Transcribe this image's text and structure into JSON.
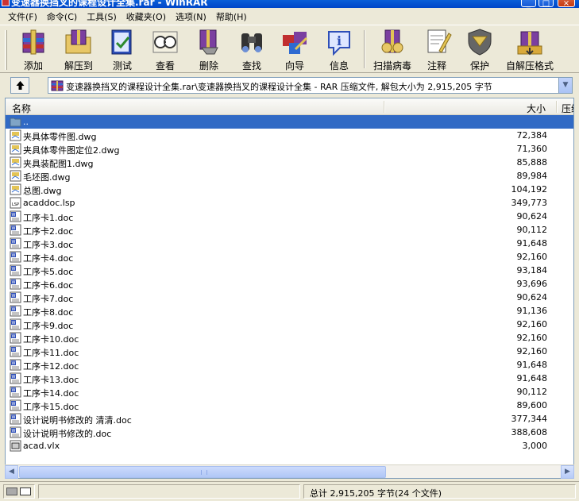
{
  "window": {
    "title": "变速器换挡叉的课程设计全集.rar - WinRAR"
  },
  "menu": [
    {
      "label": "文件(F)"
    },
    {
      "label": "命令(C)"
    },
    {
      "label": "工具(S)"
    },
    {
      "label": "收藏夹(O)"
    },
    {
      "label": "选项(N)"
    },
    {
      "label": "帮助(H)"
    }
  ],
  "toolbar": {
    "add": "添加",
    "extract": "解压到",
    "test": "测试",
    "view": "查看",
    "delete": "删除",
    "find": "查找",
    "wizard": "向导",
    "info": "信息",
    "virus_scan": "扫描病毒",
    "comment": "注释",
    "protect": "保护",
    "sfx": "自解压格式"
  },
  "address": {
    "path": "变速器换挡叉的课程设计全集.rar\\变速器换挡叉的课程设计全集 - RAR 压缩文件, 解包大小为 2,915,205 字节"
  },
  "columns": {
    "name": "名称",
    "size": "大小",
    "packed": "压缩"
  },
  "files": [
    {
      "name": "..",
      "size": "",
      "type": "folder",
      "selected": true
    },
    {
      "name": "夹具体零件图.dwg",
      "size": "72,384",
      "type": "dwg"
    },
    {
      "name": "夹具体零件图定位2.dwg",
      "size": "71,360",
      "type": "dwg"
    },
    {
      "name": "夹具装配图1.dwg",
      "size": "85,888",
      "type": "dwg"
    },
    {
      "name": "毛坯图.dwg",
      "size": "89,984",
      "type": "dwg"
    },
    {
      "name": "总图.dwg",
      "size": "104,192",
      "type": "dwg"
    },
    {
      "name": "acaddoc.lsp",
      "size": "349,773",
      "type": "lsp"
    },
    {
      "name": "工序卡1.doc",
      "size": "90,624",
      "type": "doc"
    },
    {
      "name": "工序卡2.doc",
      "size": "90,112",
      "type": "doc"
    },
    {
      "name": "工序卡3.doc",
      "size": "91,648",
      "type": "doc"
    },
    {
      "name": "工序卡4.doc",
      "size": "92,160",
      "type": "doc"
    },
    {
      "name": "工序卡5.doc",
      "size": "93,184",
      "type": "doc"
    },
    {
      "name": "工序卡6.doc",
      "size": "93,696",
      "type": "doc"
    },
    {
      "name": "工序卡7.doc",
      "size": "90,624",
      "type": "doc"
    },
    {
      "name": "工序卡8.doc",
      "size": "91,136",
      "type": "doc"
    },
    {
      "name": "工序卡9.doc",
      "size": "92,160",
      "type": "doc"
    },
    {
      "name": "工序卡10.doc",
      "size": "92,160",
      "type": "doc"
    },
    {
      "name": "工序卡11.doc",
      "size": "92,160",
      "type": "doc"
    },
    {
      "name": "工序卡12.doc",
      "size": "91,648",
      "type": "doc"
    },
    {
      "name": "工序卡13.doc",
      "size": "91,648",
      "type": "doc"
    },
    {
      "name": "工序卡14.doc",
      "size": "90,112",
      "type": "doc"
    },
    {
      "name": "工序卡15.doc",
      "size": "89,600",
      "type": "doc"
    },
    {
      "name": "设计说明书修改的 清清.doc",
      "size": "377,344",
      "type": "doc"
    },
    {
      "name": "设计说明书修改的.doc",
      "size": "388,608",
      "type": "doc"
    },
    {
      "name": "acad.vlx",
      "size": "3,000",
      "type": "vlx"
    }
  ],
  "status": {
    "total": "总计 2,915,205 字节(24 个文件)"
  },
  "colors": {
    "selection": "#316ac5",
    "titlebar": "#0a5fd8",
    "chrome": "#ece9d8"
  }
}
